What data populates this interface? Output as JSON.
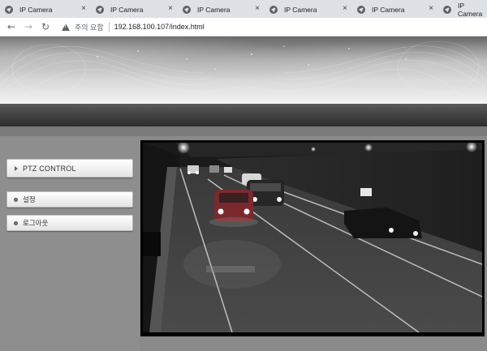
{
  "browser": {
    "tabs": [
      {
        "title": "IP Camera"
      },
      {
        "title": "IP Camera"
      },
      {
        "title": "IP Camera"
      },
      {
        "title": "IP Camera"
      },
      {
        "title": "IP Camera"
      },
      {
        "title": "IP Camera"
      }
    ],
    "close_glyph": "×",
    "security_warning": "주의 요함",
    "url": "192.168.100.107/index.html",
    "icons": [
      "back-arrow-icon",
      "forward-arrow-icon",
      "reload-icon",
      "warning-icon",
      "globe-icon",
      "close-icon"
    ]
  },
  "sidebar": {
    "ptz_label": "PTZ CONTROL",
    "settings_label": "설정",
    "logout_label": "로그아웃"
  },
  "colors": {
    "page_bg": "#8c8c8c",
    "header_dark_bar": "#3a3a3a",
    "button_bg": "#f0f0f0",
    "video_frame": "#000000"
  }
}
